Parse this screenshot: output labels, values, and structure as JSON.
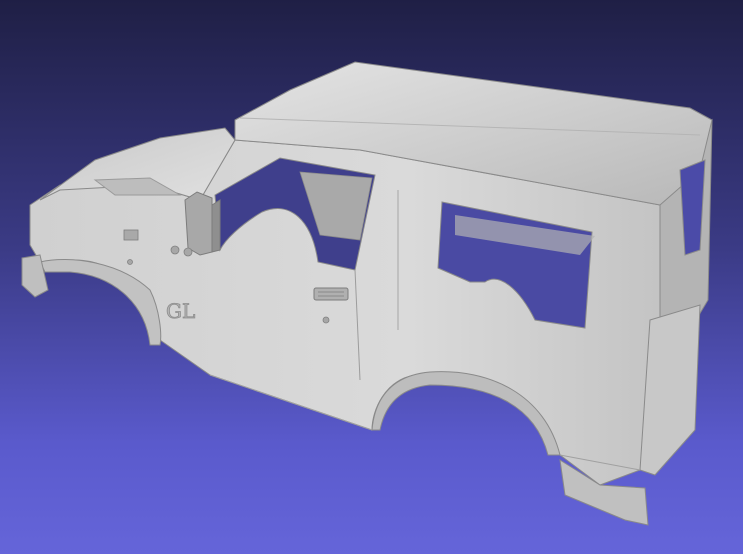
{
  "viewer": {
    "background_top": "#1f1f45",
    "background_bottom": "#6565d9",
    "mesh_base_color": "#d2d2d2"
  },
  "model": {
    "badge_text": "GL"
  }
}
